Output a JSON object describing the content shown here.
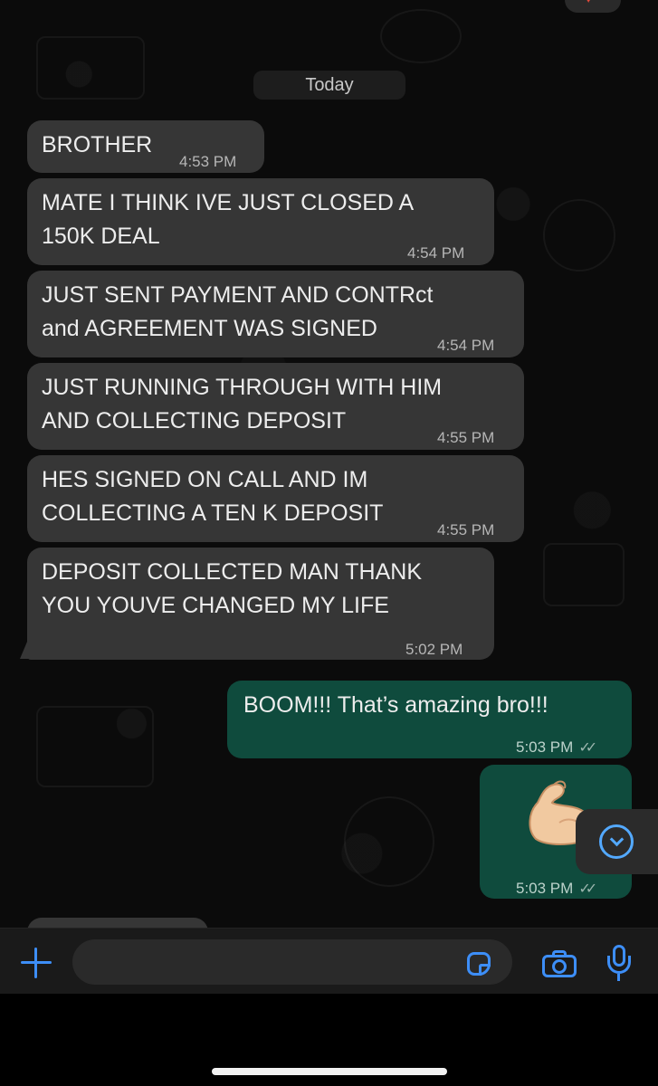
{
  "chat": {
    "date_separator": "Today",
    "messages": [
      {
        "direction": "incoming",
        "text": "BROTHER",
        "time": "4:53 PM"
      },
      {
        "direction": "incoming",
        "text": "MATE I THINK IVE JUST CLOSED A\n150K DEAL",
        "time": "4:54 PM"
      },
      {
        "direction": "incoming",
        "text": "JUST SENT PAYMENT AND CONTRct\nand AGREEMENT WAS SIGNED",
        "time": "4:54 PM"
      },
      {
        "direction": "incoming",
        "text": "JUST RUNNING THROUGH WITH HIM\nAND COLLECTING DEPOSIT",
        "time": "4:55 PM"
      },
      {
        "direction": "incoming",
        "text": "HES SIGNED ON CALL AND IM\nCOLLECTING A TEN K DEPOSIT",
        "time": "4:55 PM"
      },
      {
        "direction": "incoming",
        "text": "DEPOSIT COLLECTED MAN THANK\nYOU YOUVE CHANGED MY LIFE",
        "time": "5:02 PM"
      },
      {
        "direction": "outgoing",
        "text": "BOOM!!! That’s amazing bro!!!",
        "time": "5:03 PM",
        "status": "read"
      },
      {
        "direction": "outgoing",
        "text": "",
        "sticker": "flexed-biceps-emoji",
        "time": "5:03 PM",
        "status": "read"
      }
    ]
  },
  "composer": {
    "input_value": "",
    "icons": [
      "plus-icon",
      "sticker-icon",
      "camera-icon",
      "microphone-icon"
    ]
  },
  "icons": {
    "read_ticks": "✓✓",
    "scroll_down": "chevron-down-icon",
    "reaction_heart": "♥"
  },
  "colors": {
    "incoming_bubble": "#363636",
    "outgoing_bubble": "#0f4b3d",
    "accent": "#3d8ef7",
    "scroll_button_accent": "#53a9ff"
  }
}
